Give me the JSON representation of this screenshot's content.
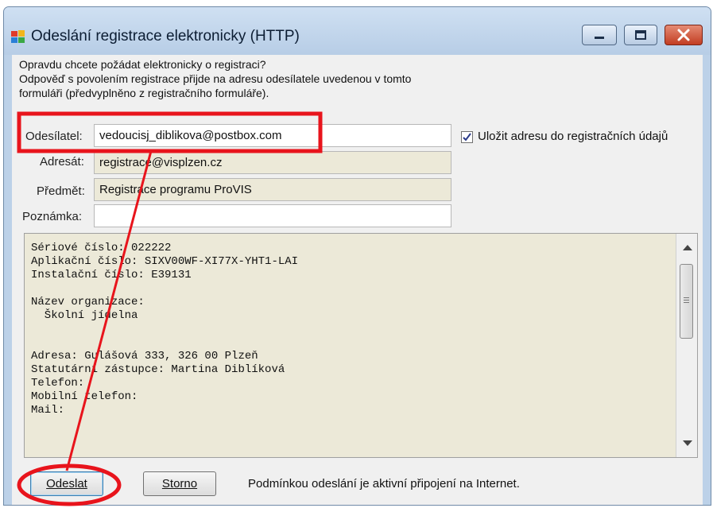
{
  "window": {
    "title": "Odeslání registrace elektronicky (HTTP)",
    "controls": [
      "minimize-icon",
      "maximize-icon",
      "close-icon"
    ]
  },
  "intro": {
    "line1": "Opravdu chcete požádat elektronicky o registraci?",
    "line2": "Odpověď s povolením registrace přijde na adresu odesílatele uvedenou v tomto",
    "line3": "formuláři (předvyplněno z registračního formuláře)."
  },
  "form": {
    "sender_label": "Odesílatel:",
    "sender_value": "vedoucisj_diblikova@postbox.com",
    "recipient_label": "Adresát:",
    "recipient_value": "registrace@visplzen.cz",
    "subject_label": "Předmět:",
    "subject_value": "Registrace programu ProVIS",
    "note_label": "Poznámka:",
    "note_value": "",
    "save_address_label": "Uložit adresu do registračních údajů",
    "save_address_checked": true
  },
  "summary": {
    "text": "Sériové číslo: 022222\nAplikační číslo: SIXV00WF-XI77X-YHT1-LAI\nInstalační číslo: E39131\n\nNázev organizace:\n  Školní jídelna\n\n\nAdresa: Gulášová 333, 326 00 Plzeň\nStatutární zástupce: Martina Diblíková\nTelefon:\nMobilní telefon:\nMail:"
  },
  "buttons": {
    "send_label": "Odeslat",
    "cancel_label": "Storno"
  },
  "status_text": "Podmínkou odeslání je aktivní připojení na Internet.",
  "colors": {
    "annotation": "#e8141c",
    "title_bar": "#bcd1e8",
    "readonly_field": "#ece9d8"
  }
}
